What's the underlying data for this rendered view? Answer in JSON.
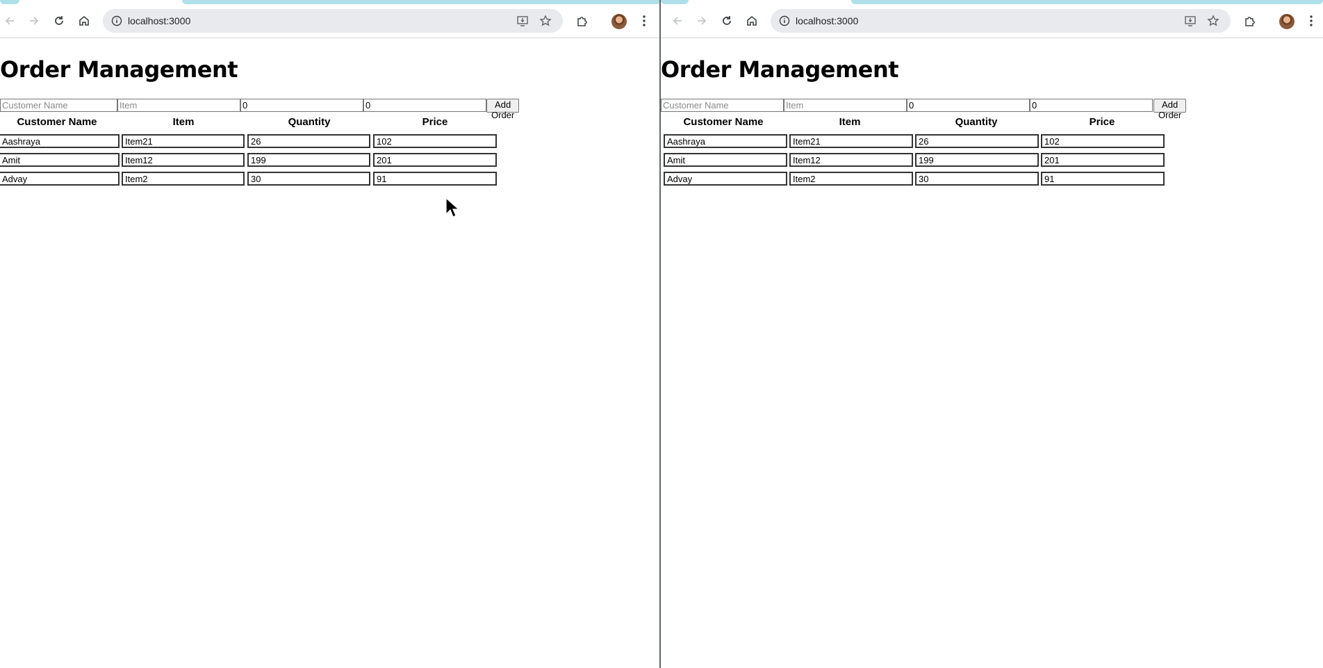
{
  "browser": {
    "url": "localhost:3000"
  },
  "app": {
    "title": "Order Management",
    "form": {
      "customer_placeholder": "Customer Name",
      "item_placeholder": "Item",
      "quantity_value": "0",
      "price_value": "0",
      "add_button_label": "Add Order"
    },
    "table": {
      "headers": [
        "Customer Name",
        "Item",
        "Quantity",
        "Price"
      ],
      "rows": [
        [
          "Aashraya",
          "Item21",
          "26",
          "102"
        ],
        [
          "Amit",
          "Item12",
          "199",
          "201"
        ],
        [
          "Advay",
          "Item2",
          "30",
          "91"
        ]
      ]
    }
  },
  "icons": {
    "back": "back-arrow-icon",
    "forward": "forward-arrow-icon",
    "reload": "reload-icon",
    "home": "home-icon",
    "site_info": "info-icon",
    "install": "install-app-icon",
    "bookmark": "star-icon",
    "extensions": "puzzle-icon",
    "profile": "avatar",
    "menu": "kebab-menu-icon"
  },
  "colors": {
    "tab_strip": "#aee0ea",
    "omnibox": "#e8eaed",
    "divider": "#5f6368"
  }
}
